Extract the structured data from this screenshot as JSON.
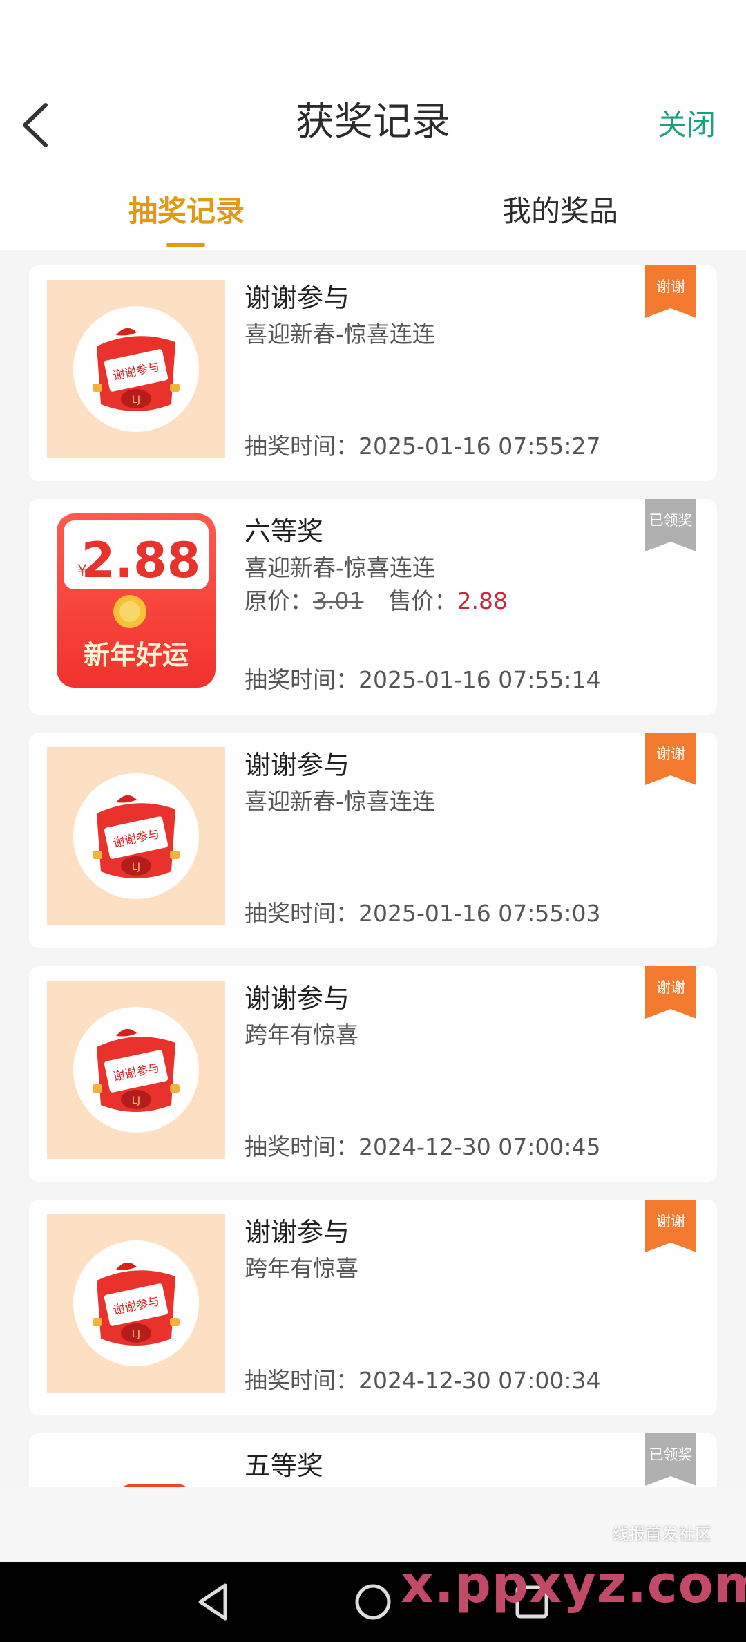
{
  "header": {
    "title": "获奖记录",
    "close_label": "关闭",
    "back_icon": "back-arrow-icon"
  },
  "tabs": [
    {
      "label": "抽奖记录",
      "active": true
    },
    {
      "label": "我的奖品",
      "active": false
    }
  ],
  "colors": {
    "accent": "#e09b16",
    "close": "#1aa37a",
    "badge_thanks": "#f47a2f",
    "badge_claimed": "#b0b0b0",
    "sale_price": "#c42a3a"
  },
  "records": [
    {
      "name": "谢谢参与",
      "activity": "喜迎新春-惊喜连连",
      "time": "抽奖时间：2025-01-16 07:55:27",
      "badge": "谢谢",
      "image": "thanks"
    },
    {
      "name": "六等奖",
      "activity": "喜迎新春-惊喜连连",
      "orig_label": "原价：",
      "orig_price": "3.01",
      "sale_label": "售价：",
      "sale_price": "2.88",
      "time": "抽奖时间：2025-01-16 07:55:14",
      "badge": "已领奖",
      "image": "redpack",
      "image_amount": "2.88",
      "image_currency": "¥",
      "image_text": "新年好运"
    },
    {
      "name": "谢谢参与",
      "activity": "喜迎新春-惊喜连连",
      "time": "抽奖时间：2025-01-16 07:55:03",
      "badge": "谢谢",
      "image": "thanks"
    },
    {
      "name": "谢谢参与",
      "activity": "跨年有惊喜",
      "time": "抽奖时间：2024-12-30 07:00:45",
      "badge": "谢谢",
      "image": "thanks"
    },
    {
      "name": "谢谢参与",
      "activity": "跨年有惊喜",
      "time": "抽奖时间：2024-12-30 07:00:34",
      "badge": "谢谢",
      "image": "thanks"
    },
    {
      "name": "五等奖",
      "badge": "已领奖",
      "image": "partial"
    }
  ],
  "thanks_image_text": "谢谢参与",
  "watermark": {
    "text": "x.ppxyz.com",
    "sub": "线报首发社区"
  }
}
